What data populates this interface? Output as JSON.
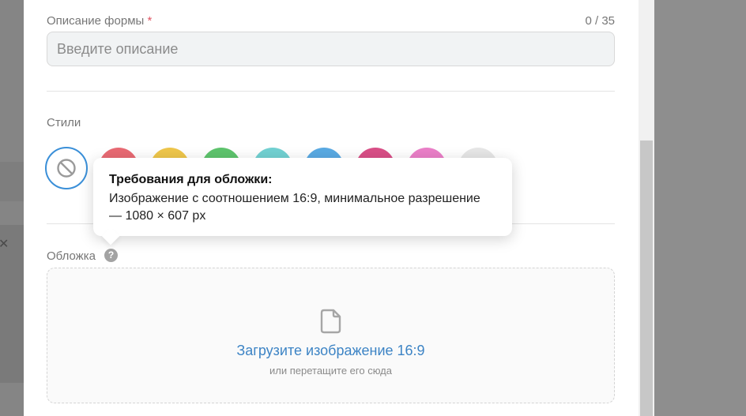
{
  "form": {
    "description": {
      "label": "Описание формы",
      "required_mark": "*",
      "counter": "0 / 35",
      "value": "",
      "placeholder": "Введите описание"
    },
    "styles": {
      "label": "Стили",
      "swatches": [
        {
          "name": "none",
          "icon": "no-style-icon",
          "selected": true
        },
        {
          "name": "red",
          "color": "#e86a73"
        },
        {
          "name": "yellow",
          "color": "#eec64b"
        },
        {
          "name": "green",
          "color": "#5ec46d"
        },
        {
          "name": "teal",
          "color": "#72d1d2"
        },
        {
          "name": "blue",
          "color": "#5aaae3"
        },
        {
          "name": "magenta",
          "color": "#d94f87"
        },
        {
          "name": "pink",
          "color": "#ea7fc8"
        },
        {
          "name": "gray",
          "color": "#e6e6e6"
        }
      ]
    },
    "cover": {
      "label": "Обложка",
      "help_icon": "question-icon",
      "help_glyph": "?",
      "upload_text": "Загрузите изображение 16:9",
      "upload_hint": "или перетащите его сюда",
      "upload_icon": "file-icon"
    }
  },
  "tooltip": {
    "title": "Требования для обложки:",
    "body": "Изображение с соотношением 16:9, минимальное разрешение — 1080 × 607 px"
  },
  "colors": {
    "accent": "#3a8fd8",
    "link": "#3d84c5",
    "required": "#e05563"
  }
}
